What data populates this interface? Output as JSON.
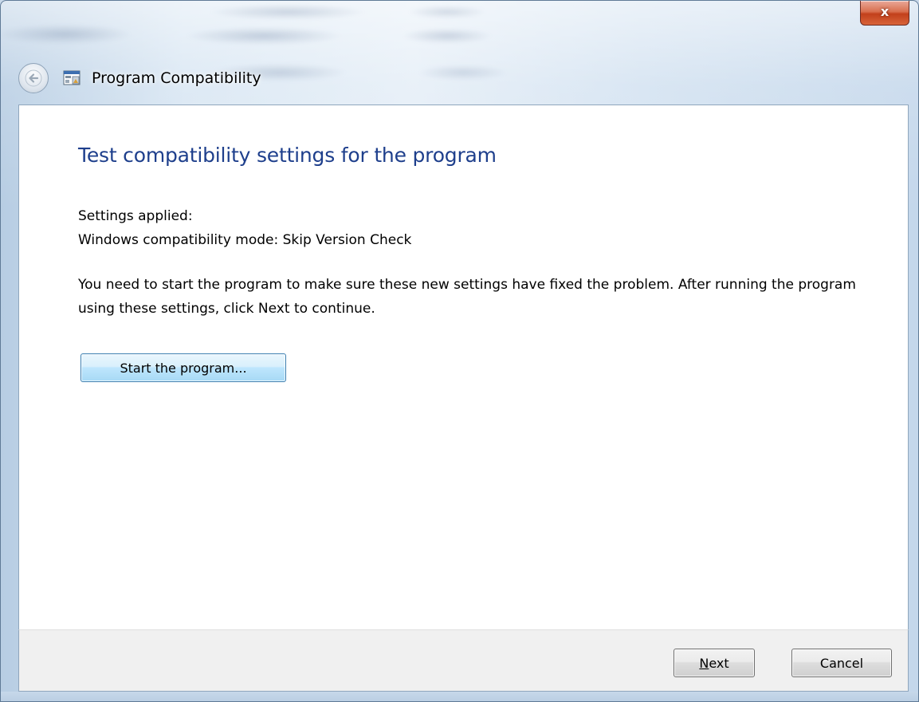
{
  "window": {
    "title": "Program Compatibility",
    "close_label": "x"
  },
  "page": {
    "heading": "Test compatibility settings for the program",
    "settings_label": "Settings applied:",
    "settings_value": "Windows compatibility mode: Skip Version Check",
    "description": "You need to start the program to make sure these new settings have fixed the problem. After running the program using these settings, click Next to continue.",
    "start_button_label": "Start the program..."
  },
  "footer": {
    "next_accel": "N",
    "next_rest": "ext",
    "cancel_label": "Cancel"
  },
  "icons": {
    "back": "back-arrow-icon",
    "program": "program-compatibility-icon",
    "close": "close-icon"
  },
  "colors": {
    "heading": "#1e3f8c",
    "close_button": "#c2401b",
    "start_button_border": "#3c7fb1"
  }
}
